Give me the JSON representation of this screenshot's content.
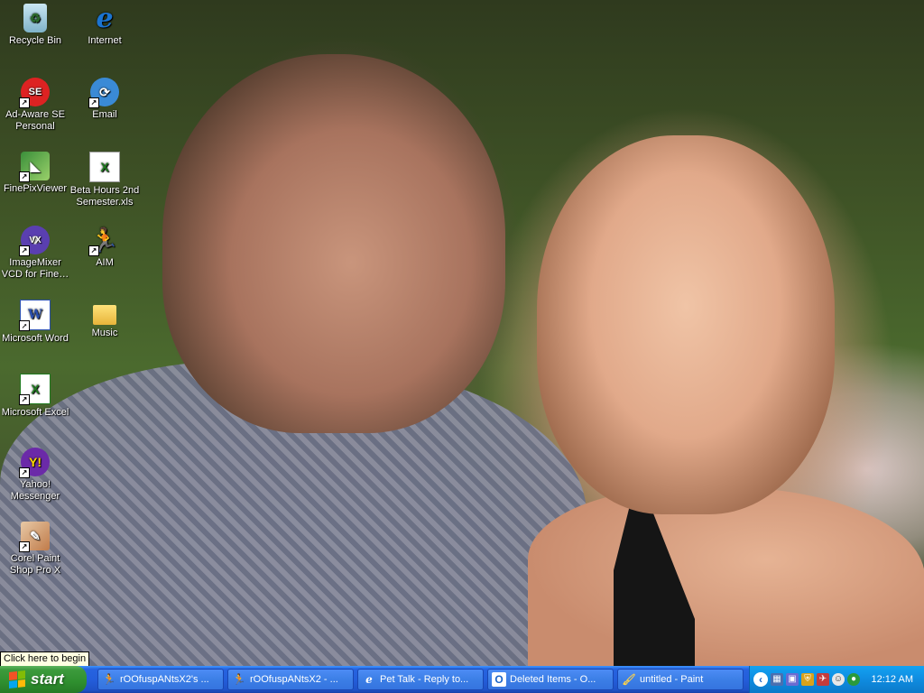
{
  "desktop": {
    "icons": [
      {
        "label": "Recycle Bin",
        "icon": "recycle-bin-icon"
      },
      {
        "label": "Internet",
        "icon": "internet-explorer-icon"
      },
      {
        "label": "Ad-Aware SE Personal",
        "icon": "ad-aware-icon"
      },
      {
        "label": "Email",
        "icon": "email-icon"
      },
      {
        "label": "FinePixViewer",
        "icon": "finepix-viewer-icon"
      },
      {
        "label": "Beta Hours 2nd Semester.xls",
        "icon": "excel-file-icon"
      },
      {
        "label": "ImageMixer VCD for Fine…",
        "icon": "imagemixer-cd-icon"
      },
      {
        "label": "AIM",
        "icon": "aim-running-man-icon"
      },
      {
        "label": "Microsoft Word",
        "icon": "word-icon"
      },
      {
        "label": "Music",
        "icon": "folder-icon"
      },
      {
        "label": "Microsoft Excel",
        "icon": "excel-icon"
      },
      {
        "label": "Yahoo! Messenger",
        "icon": "yahoo-messenger-icon"
      },
      {
        "label": "Corel Paint Shop Pro X",
        "icon": "corel-paint-shop-icon"
      }
    ]
  },
  "tooltip": "Click here to begin",
  "taskbar": {
    "start_label": "start",
    "tasks": [
      {
        "label": "rOOfuspANtsX2's ...",
        "icon": "aim-running-man-icon"
      },
      {
        "label": "rOOfuspANtsX2 - ...",
        "icon": "aim-running-man-icon"
      },
      {
        "label": "Pet Talk - Reply to...",
        "icon": "internet-explorer-icon"
      },
      {
        "label": "Deleted Items - O...",
        "icon": "outlook-icon"
      },
      {
        "label": "untitled - Paint",
        "icon": "paint-icon"
      }
    ],
    "tray": {
      "clock": "12:12 AM",
      "icons": [
        "network-icon",
        "display-icon",
        "security-icon",
        "satellite-icon",
        "yahoo-tray-icon",
        "messenger-tray-icon"
      ]
    }
  },
  "colors": {
    "taskbar_blue": "#245edb",
    "start_green": "#3c9a3c",
    "tray_blue": "#0f8ce0",
    "tooltip_bg": "#ffffe1"
  }
}
